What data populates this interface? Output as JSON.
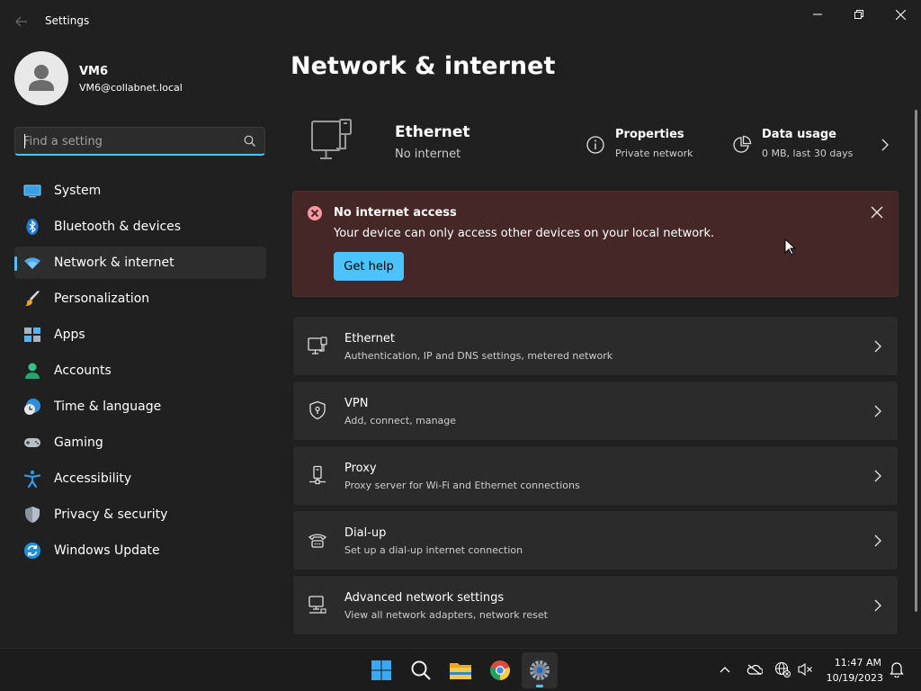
{
  "window": {
    "title": "Settings"
  },
  "profile": {
    "name": "VM6",
    "email": "VM6@collabnet.local"
  },
  "search": {
    "placeholder": "Find a setting"
  },
  "sidebar": {
    "items": [
      {
        "label": "System",
        "icon": "system-icon"
      },
      {
        "label": "Bluetooth & devices",
        "icon": "bluetooth-icon"
      },
      {
        "label": "Network & internet",
        "icon": "wifi-icon",
        "active": true
      },
      {
        "label": "Personalization",
        "icon": "brush-icon"
      },
      {
        "label": "Apps",
        "icon": "apps-icon"
      },
      {
        "label": "Accounts",
        "icon": "accounts-icon"
      },
      {
        "label": "Time & language",
        "icon": "clock-globe-icon"
      },
      {
        "label": "Gaming",
        "icon": "gamepad-icon"
      },
      {
        "label": "Accessibility",
        "icon": "accessibility-icon"
      },
      {
        "label": "Privacy & security",
        "icon": "shield-icon"
      },
      {
        "label": "Windows Update",
        "icon": "update-icon"
      }
    ]
  },
  "main": {
    "title": "Network & internet",
    "hero": {
      "title": "Ethernet",
      "status": "No internet",
      "properties": {
        "title": "Properties",
        "subtitle": "Private network"
      },
      "data_usage": {
        "title": "Data usage",
        "subtitle": "0 MB, last 30 days"
      }
    },
    "alert": {
      "title": "No internet access",
      "message": "Your device can only access other devices on your local network.",
      "button": "Get help"
    },
    "cards": [
      {
        "title": "Ethernet",
        "subtitle": "Authentication, IP and DNS settings, metered network",
        "icon": "ethernet-icon"
      },
      {
        "title": "VPN",
        "subtitle": "Add, connect, manage",
        "icon": "vpn-shield-icon"
      },
      {
        "title": "Proxy",
        "subtitle": "Proxy server for Wi-Fi and Ethernet connections",
        "icon": "proxy-icon"
      },
      {
        "title": "Dial-up",
        "subtitle": "Set up a dial-up internet connection",
        "icon": "dialup-icon"
      },
      {
        "title": "Advanced network settings",
        "subtitle": "View all network adapters, network reset",
        "icon": "advanced-network-icon"
      }
    ]
  },
  "taskbar": {
    "apps": [
      "start-icon",
      "search-icon",
      "file-explorer-icon",
      "chrome-icon",
      "settings-icon"
    ],
    "tray": [
      "chevron-up-icon",
      "onedrive-icon",
      "network-globe-icon",
      "volume-muted-icon"
    ],
    "time": "11:47 AM",
    "date": "10/19/2023"
  },
  "colors": {
    "accent": "#4cc2ff",
    "alert_bg": "#442726",
    "background": "#202020",
    "card_bg": "#2b2b2b"
  }
}
